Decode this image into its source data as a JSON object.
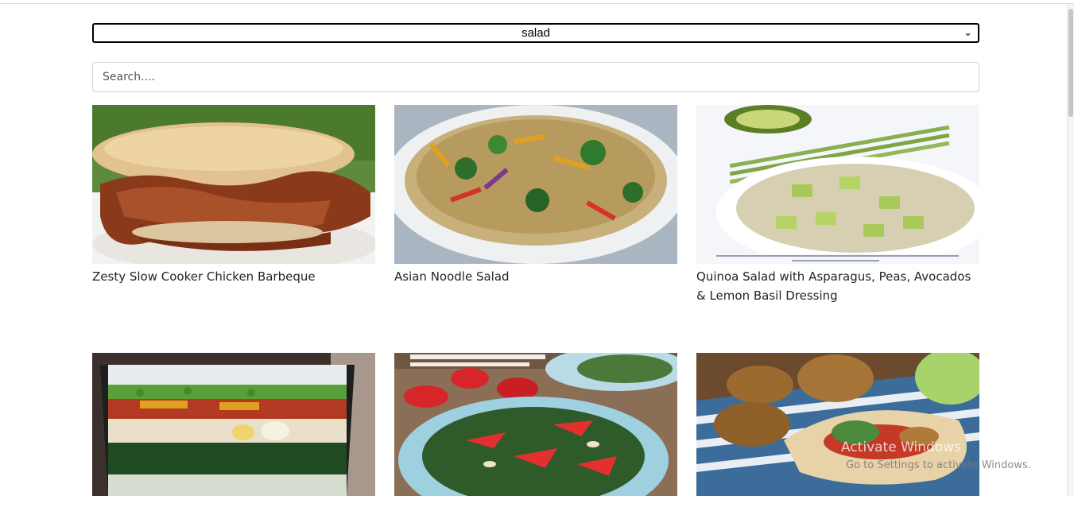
{
  "filter": {
    "selected": "salad"
  },
  "search": {
    "placeholder": "Search...."
  },
  "recipes": [
    {
      "title": "Zesty Slow Cooker Chicken Barbeque",
      "image": "bbq-sandwich-image"
    },
    {
      "title": "Asian Noodle Salad",
      "image": "noodle-salad-image"
    },
    {
      "title": "Quinoa Salad with Asparagus, Peas, Avocados & Lemon Basil Dressing",
      "image": "quinoa-salad-image"
    },
    {
      "title": "",
      "image": "layered-salad-image"
    },
    {
      "title": "",
      "image": "strawberry-kale-salad-image"
    },
    {
      "title": "",
      "image": "falafel-pita-image"
    }
  ],
  "os_overlay": {
    "activate_title": "Activate Windows",
    "activate_sub": "Go to Settings to activate Windows."
  }
}
